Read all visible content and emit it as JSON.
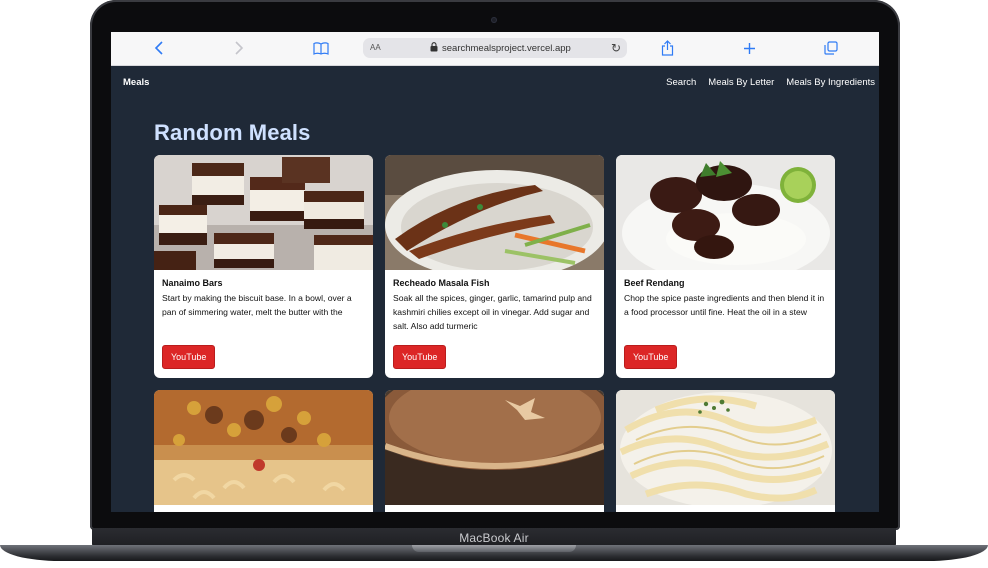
{
  "device": {
    "label": "MacBook Air"
  },
  "browser": {
    "text_size_label": "AA",
    "url": "searchmealsproject.vercel.app",
    "icons": [
      "back-icon",
      "forward-icon",
      "bookmarks-icon",
      "lock-icon",
      "reload-icon",
      "share-icon",
      "new-tab-icon",
      "tabs-icon"
    ],
    "accent_color": "#2f7bf5"
  },
  "site": {
    "brand": "Meals",
    "nav": [
      "Search",
      "Meals By Letter",
      "Meals By Ingredients"
    ],
    "page_title": "Random Meals",
    "background_color": "#1f2937",
    "title_color": "#cfe1ff",
    "button_color": "#dc2626"
  },
  "meals": [
    {
      "name": "Nanaimo Bars",
      "description": "Start by making the biscuit base. In a bowl, over a pan of simmering water, melt the butter with the",
      "button": "YouTube",
      "image": "nanaimo-bars-photo"
    },
    {
      "name": "Recheado Masala Fish",
      "description": "Soak all the spices, ginger, garlic, tamarind pulp and kashmiri chilies except oil in vinegar. Add sugar and salt. Also add turmeric",
      "button": "YouTube",
      "image": "masala-fish-photo"
    },
    {
      "name": "Beef Rendang",
      "description": "Chop the spice paste ingredients and then blend it in a food processor until fine. Heat the oil in a stew",
      "button": "YouTube",
      "image": "beef-rendang-photo"
    },
    {
      "image": "koshari-photo"
    },
    {
      "image": "pie-photo"
    },
    {
      "image": "fettuccine-photo"
    }
  ]
}
